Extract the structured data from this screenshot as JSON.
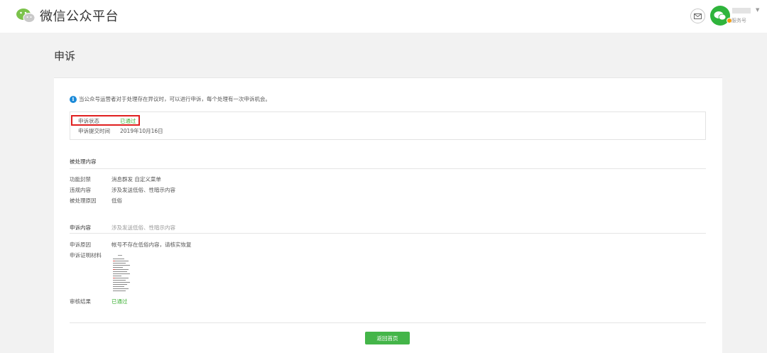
{
  "header": {
    "title": "微信公众平台",
    "account_type": "服务号"
  },
  "page": {
    "title": "申诉"
  },
  "notice": "当公众号运营者对于处理存在异议时，可以进行申诉，每个处理有一次申诉机会。",
  "status": {
    "state_label": "申诉状态",
    "state_value": "已通过",
    "time_label": "申诉提交时间",
    "time_value": "2019年10月16日"
  },
  "handled": {
    "section_title": "被处理内容",
    "rows": [
      {
        "label": "功能封禁",
        "value": "消息群发 自定义菜单"
      },
      {
        "label": "违规内容",
        "value": "涉及发送低俗、性暗示内容"
      },
      {
        "label": "被处理原因",
        "value": "低俗"
      }
    ]
  },
  "appeal": {
    "section_title": "申诉内容",
    "section_value": "涉及发送低俗、性暗示内容",
    "reason_label": "申诉原因",
    "reason_value": "帐号不存在低俗内容，请核实恢复",
    "evidence_label": "申诉证明材料",
    "result_label": "审核结果",
    "result_value": "已通过"
  },
  "actions": {
    "back_label": "返回首页"
  },
  "colors": {
    "brand_green": "#44b549",
    "status_green": "#3cb034",
    "highlight_red": "#e02020",
    "info_blue": "#1b8ad8"
  }
}
